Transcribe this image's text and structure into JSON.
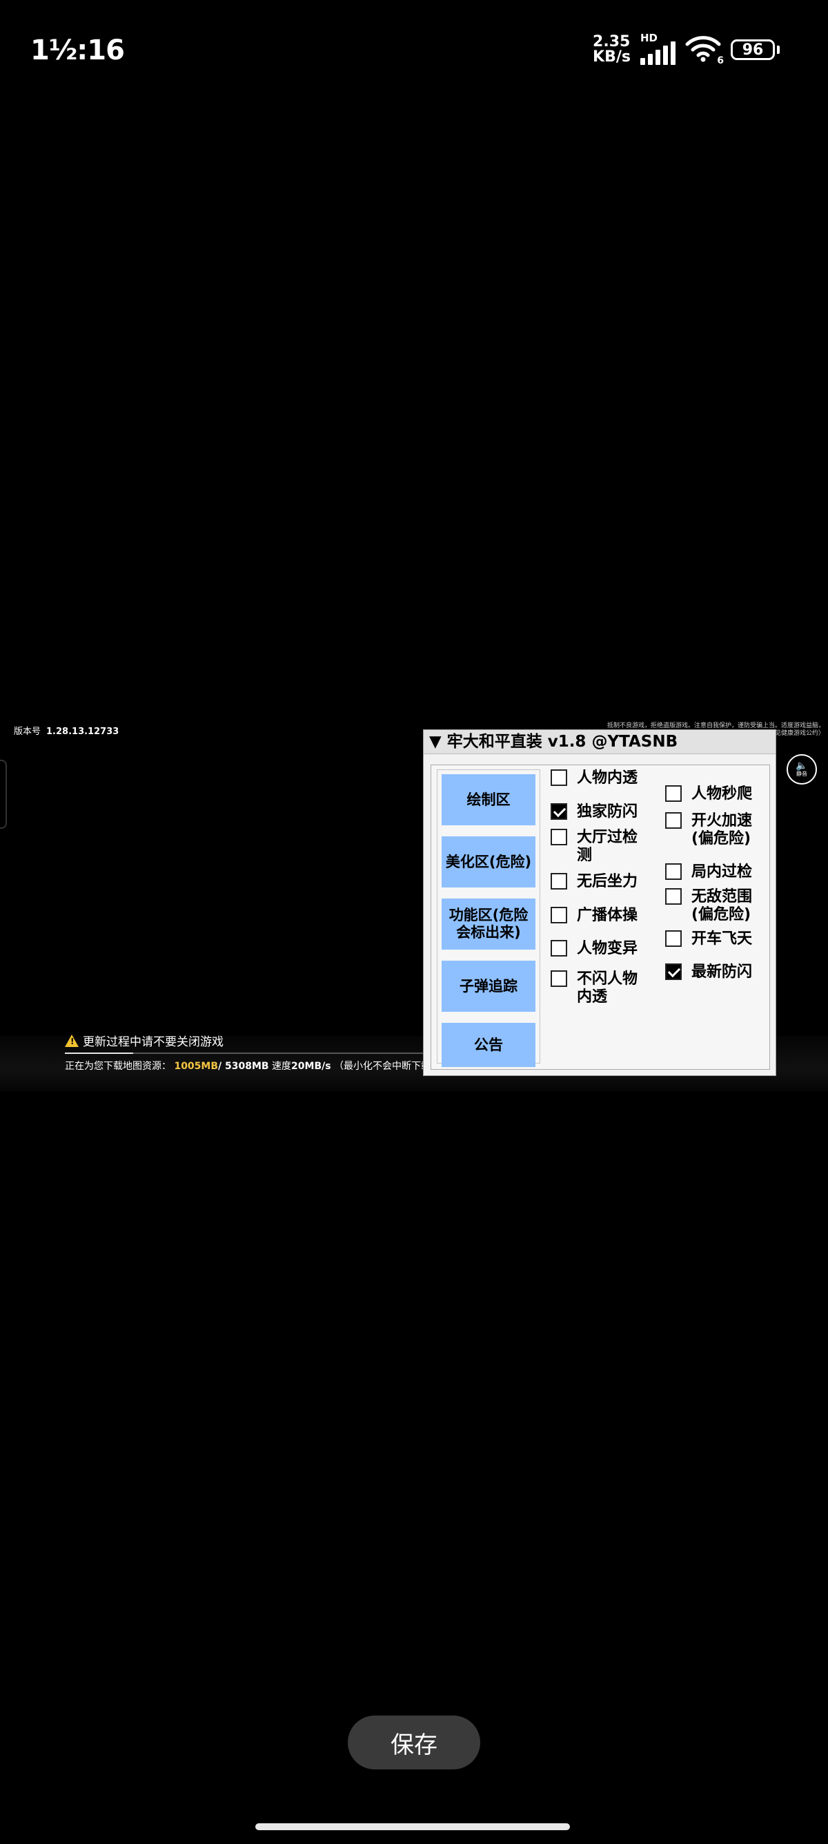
{
  "status_bar": {
    "time": "1½:16",
    "net_speed_value": "2.35",
    "net_speed_unit": "KB/s",
    "hd_label": "HD",
    "wifi_number": "6",
    "battery": "96",
    "icons": [
      "signal-bars-icon",
      "wifi-icon",
      "battery-icon"
    ]
  },
  "game": {
    "version_label": "版本号",
    "version_number": "1.28.13.12733",
    "corner_notice": "抵制不良游戏，拒绝盗版游戏。注意自我保护，谨防受骗上当。适度游戏益脑，沉迷游戏伤身。合理安排时间，享受健康生活。（详见健康游戏公约）",
    "mute_label": "静音",
    "warning": "更新过程中请不要关闭游戏",
    "download": {
      "prefix": "正在为您下载地图资源：",
      "done": "1005MB",
      "total": "/ 5308MB",
      "speed_label": " 速度",
      "speed": "20MB/s",
      "note": "（最小化不会中断下载）",
      "progress_fraction": 0.19
    }
  },
  "panel": {
    "title": "▼ 牢大和平直装 v1.8 @YTASNB",
    "tabs": [
      "绘制区",
      "美化区(危险)",
      "功能区(危险\n会标出来)",
      "子弹追踪",
      "公告"
    ],
    "left_options": [
      {
        "label": "人物内透",
        "checked": false
      },
      {
        "label": "独家防闪",
        "checked": true
      },
      {
        "label": "大厅过检\n测",
        "checked": false
      },
      {
        "label": "无后坐力",
        "checked": false
      },
      {
        "label": "广播体操",
        "checked": false
      },
      {
        "label": "人物变异",
        "checked": false
      },
      {
        "label": "不闪人物\n内透",
        "checked": false
      }
    ],
    "right_options": [
      {
        "label": "人物秒爬",
        "checked": false
      },
      {
        "label": "开火加速\n(偏危险)",
        "checked": false
      },
      {
        "label": "局内过检",
        "checked": false
      },
      {
        "label": "无敌范围\n(偏危险)",
        "checked": false
      },
      {
        "label": "开车飞天",
        "checked": false
      },
      {
        "label": "最新防闪",
        "checked": true
      }
    ]
  },
  "save_button": "保存",
  "colors": {
    "background": "#000000",
    "tab_blue": "#8ec0ff",
    "panel_bg": "#f2f2f2",
    "download_highlight": "#f5c543",
    "warning_yellow": "#f2c230"
  }
}
